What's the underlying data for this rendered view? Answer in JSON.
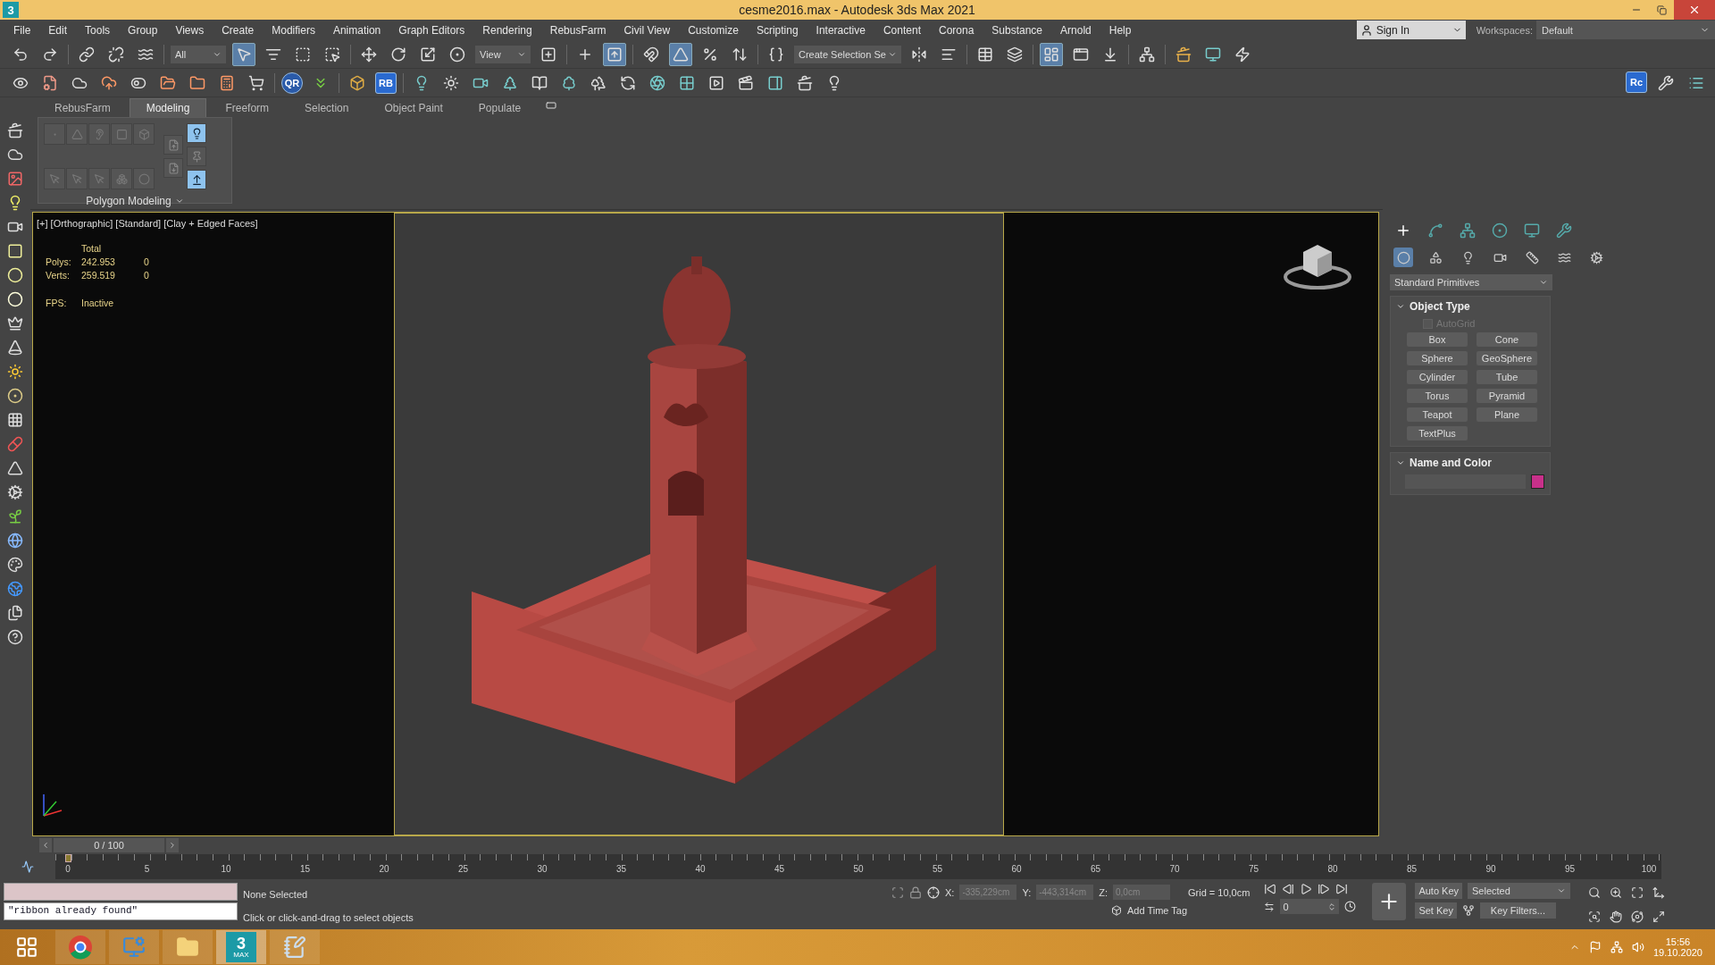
{
  "window": {
    "logo": "3",
    "title": "cesme2016.max - Autodesk 3ds Max 2021"
  },
  "menu": [
    "File",
    "Edit",
    "Tools",
    "Group",
    "Views",
    "Create",
    "Modifiers",
    "Animation",
    "Graph Editors",
    "Rendering",
    "RebusFarm",
    "Civil View",
    "Customize",
    "Scripting",
    "Interactive",
    "Content",
    "Corona",
    "Substance",
    "Arnold",
    "Help"
  ],
  "account": {
    "sign_in": "Sign In",
    "workspaces_label": "Workspaces:",
    "workspace": "Default"
  },
  "toolbar": {
    "selection_filter": "All",
    "reference_coord": "View",
    "named_selection": "Create Selection Se",
    "rb_label": "RB",
    "qr_label": "QR",
    "rc_label": "Rc"
  },
  "ribbon": {
    "tabs": [
      {
        "label": "RebusFarm",
        "selected": false
      },
      {
        "label": "Modeling",
        "selected": true
      },
      {
        "label": "Freeform",
        "selected": false
      },
      {
        "label": "Selection",
        "selected": false
      },
      {
        "label": "Object Paint",
        "selected": false
      },
      {
        "label": "Populate",
        "selected": false
      }
    ],
    "panel": "Polygon Modeling"
  },
  "viewport": {
    "label": "[+] [Orthographic] [Standard] [Clay + Edged Faces]",
    "stats": {
      "header": "Total",
      "rows": [
        {
          "label": "Polys:",
          "total": "242.953",
          "selected": "0"
        },
        {
          "label": "Verts:",
          "total": "259.519",
          "selected": "0"
        }
      ],
      "fps_label": "FPS:",
      "fps": "Inactive"
    }
  },
  "command_panel": {
    "category": "Standard Primitives",
    "rollouts": [
      {
        "kind": "object_type",
        "title": "Object Type",
        "autogrid": {
          "label": "AutoGrid",
          "checked": false,
          "disabled": true
        },
        "buttons": [
          "Box",
          "Cone",
          "Sphere",
          "GeoSphere",
          "Cylinder",
          "Tube",
          "Torus",
          "Pyramid",
          "Teapot",
          "Plane",
          "TextPlus"
        ]
      },
      {
        "kind": "name_color",
        "title": "Name and Color",
        "color": "#c8308a"
      }
    ]
  },
  "timeline": {
    "slider": "0 / 100",
    "level": 0,
    "ticks": [
      "0",
      "5",
      "10",
      "15",
      "20",
      "25",
      "30",
      "35",
      "40",
      "45",
      "50",
      "55",
      "60",
      "65",
      "70",
      "75",
      "80",
      "85",
      "90",
      "95",
      "100"
    ]
  },
  "status": {
    "listener_output": "\"ribbon already found\"",
    "selection": "None Selected",
    "prompt": "Click or click-and-drag to select objects",
    "x_label": "X:",
    "x": "-335,229cm",
    "y_label": "Y:",
    "y": "-443,314cm",
    "z_label": "Z:",
    "z": "0,0cm",
    "grid": "Grid = 10,0cm",
    "time_tag": "Add Time Tag",
    "frame": "0",
    "auto_key": "Auto Key",
    "key_mode": "Selected",
    "set_key": "Set Key",
    "key_filters": "Key Filters..."
  },
  "taskbar": {
    "app_logo": "3",
    "app_sub": "MAX",
    "time": "15:56",
    "date": "19.10.2020"
  }
}
